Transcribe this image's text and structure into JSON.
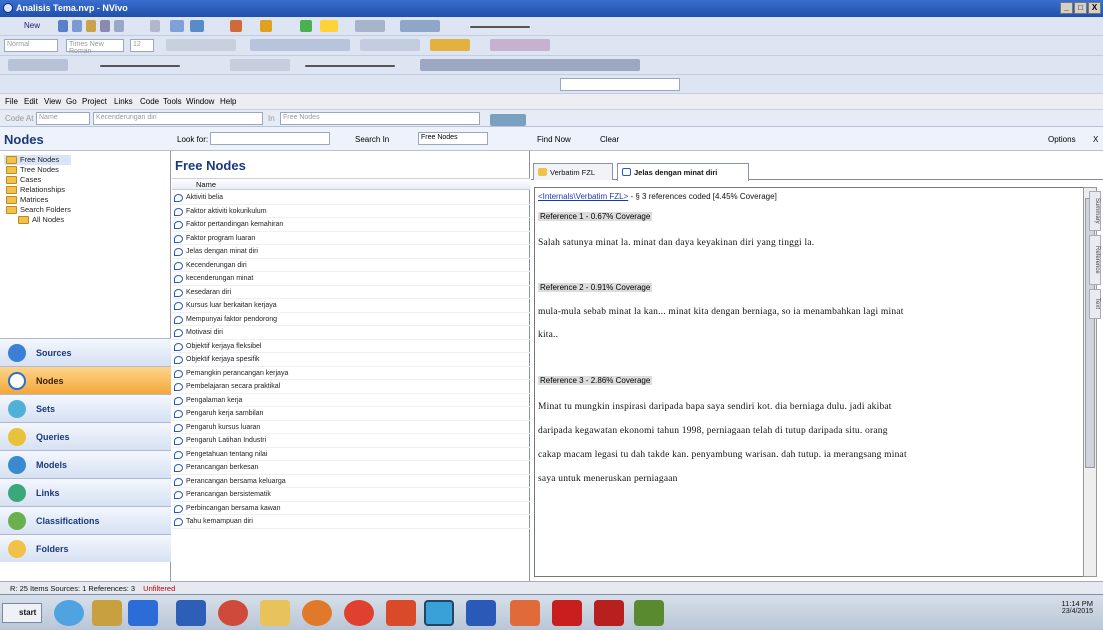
{
  "window": {
    "title": "Analisis Tema.nvp - NVivo",
    "controls": [
      "_",
      "□",
      "X"
    ]
  },
  "toolbar": {
    "new_label": "New",
    "style_value": "Normal",
    "font_value": "Times New Roman",
    "size_value": "12"
  },
  "menu": {
    "items": [
      "File",
      "Edit",
      "View",
      "Go",
      "Project",
      "Links",
      "Code",
      "Tools",
      "Window",
      "Help"
    ]
  },
  "codeat": {
    "label": "Code At",
    "name_placeholder": "Name",
    "node_value": "Kecenderungan diri",
    "in_label": "In",
    "in_value": "Free Nodes"
  },
  "find": {
    "look_for_label": "Look for:",
    "search_in_label": "Search In",
    "search_in_value": "Free Nodes",
    "find_now_label": "Find Now",
    "clear_label": "Clear",
    "options_label": "Options",
    "close": "X"
  },
  "nav": {
    "title": "Nodes",
    "tree": [
      "Free Nodes",
      "Tree Nodes",
      "Cases",
      "Relationships",
      "Matrices",
      "Search Folders",
      "All Nodes"
    ],
    "buttons": [
      "Sources",
      "Nodes",
      "Sets",
      "Queries",
      "Models",
      "Links",
      "Classifications",
      "Folders"
    ]
  },
  "list": {
    "title": "Free Nodes",
    "column": "Name",
    "items": [
      "Aktiviti belia",
      "Faktor aktiviti kokurikulum",
      "Faktor pertandingan kemahiran",
      "Faktor program luaran",
      "Jelas dengan minat diri",
      "Kecenderungan diri",
      "kecenderungan minat",
      "Kesedaran diri",
      "Kursus luar berkaitan kerjaya",
      "Mempunyai faktor pendorong",
      "Motivasi diri",
      "Objektif kerjaya fleksibel",
      "Objektif kerjaya spesifik",
      "Pemangkin perancangan kerjaya",
      "Pembelajaran secara praktikal",
      "Pengalaman kerja",
      "Pengaruh kerja sambilan",
      "Pengaruh kursus luaran",
      "Pengaruh Latihan Industri",
      "Pengetahuan tentang nilai",
      "Perancangan berkesan",
      "Perancangan bersama keluarga",
      "Perancangan bersistematik",
      "Perbincangan bersama kawan",
      "Tahu kemampuan diri"
    ]
  },
  "detail": {
    "tabs": [
      "Verbatim FZL",
      "Jelas dengan minat diri"
    ],
    "source_link": "<Internals\\Verbatim FZL>",
    "source_summary": " - § 3 references coded  [4.45% Coverage]",
    "refs": [
      {
        "header": "Reference 1 - 0.67% Coverage",
        "lines": [
          "Salah satunya minat la. minat dan daya keyakinan diri yang tinggi la."
        ]
      },
      {
        "header": "Reference 2 - 0.91% Coverage",
        "lines": [
          "mula-mula sebab minat la kan... minat kita dengan berniaga, so ia menambahkan lagi minat",
          "kita.."
        ]
      },
      {
        "header": "Reference 3 - 2.86% Coverage",
        "lines": [
          "Minat tu mungkin inspirasi daripada bapa saya sendiri kot. dia berniaga dulu. jadi akibat",
          "daripada kegawatan ekonomi tahun 1998, perniagaan telah di tutup daripada situ. orang",
          "cakap macam legasi tu dah takde kan. penyambung warisan. dah tutup. ia merangsang minat",
          "saya untuk meneruskan perniagaan"
        ]
      }
    ],
    "side_tabs": [
      "Summary",
      "Reference",
      "Text"
    ]
  },
  "status": {
    "text": "R: 25 Items  Sources: 1  References: 3",
    "filter": "Unfiltered"
  },
  "taskbar": {
    "start": "start",
    "time": "11:14 PM",
    "date": "23/4/2015"
  }
}
